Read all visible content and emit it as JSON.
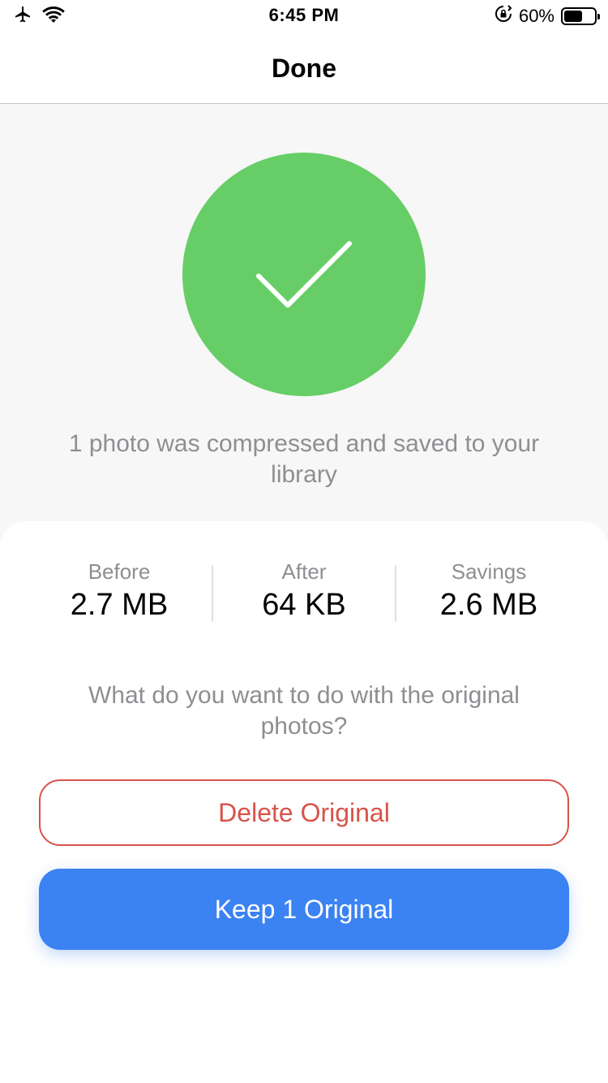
{
  "status_bar": {
    "time": "6:45 PM",
    "battery_percent": "60%",
    "battery_level": 0.6,
    "icons": [
      "airplane-icon",
      "wifi-icon",
      "orientation-lock-icon",
      "battery-icon"
    ]
  },
  "nav": {
    "title": "Done"
  },
  "success": {
    "icon": "checkmark-icon",
    "circle_color": "#67ce67",
    "message": "1 photo was compressed and saved to your library"
  },
  "stats": {
    "before": {
      "label": "Before",
      "value": "2.7 MB"
    },
    "after": {
      "label": "After",
      "value": "64 KB"
    },
    "savings": {
      "label": "Savings",
      "value": "2.6 MB"
    }
  },
  "question": "What do you want to do with the original photos?",
  "actions": {
    "delete_label": "Delete Original",
    "delete_color": "#d9534a",
    "keep_label": "Keep 1 Original",
    "keep_color": "#3b82f3"
  }
}
